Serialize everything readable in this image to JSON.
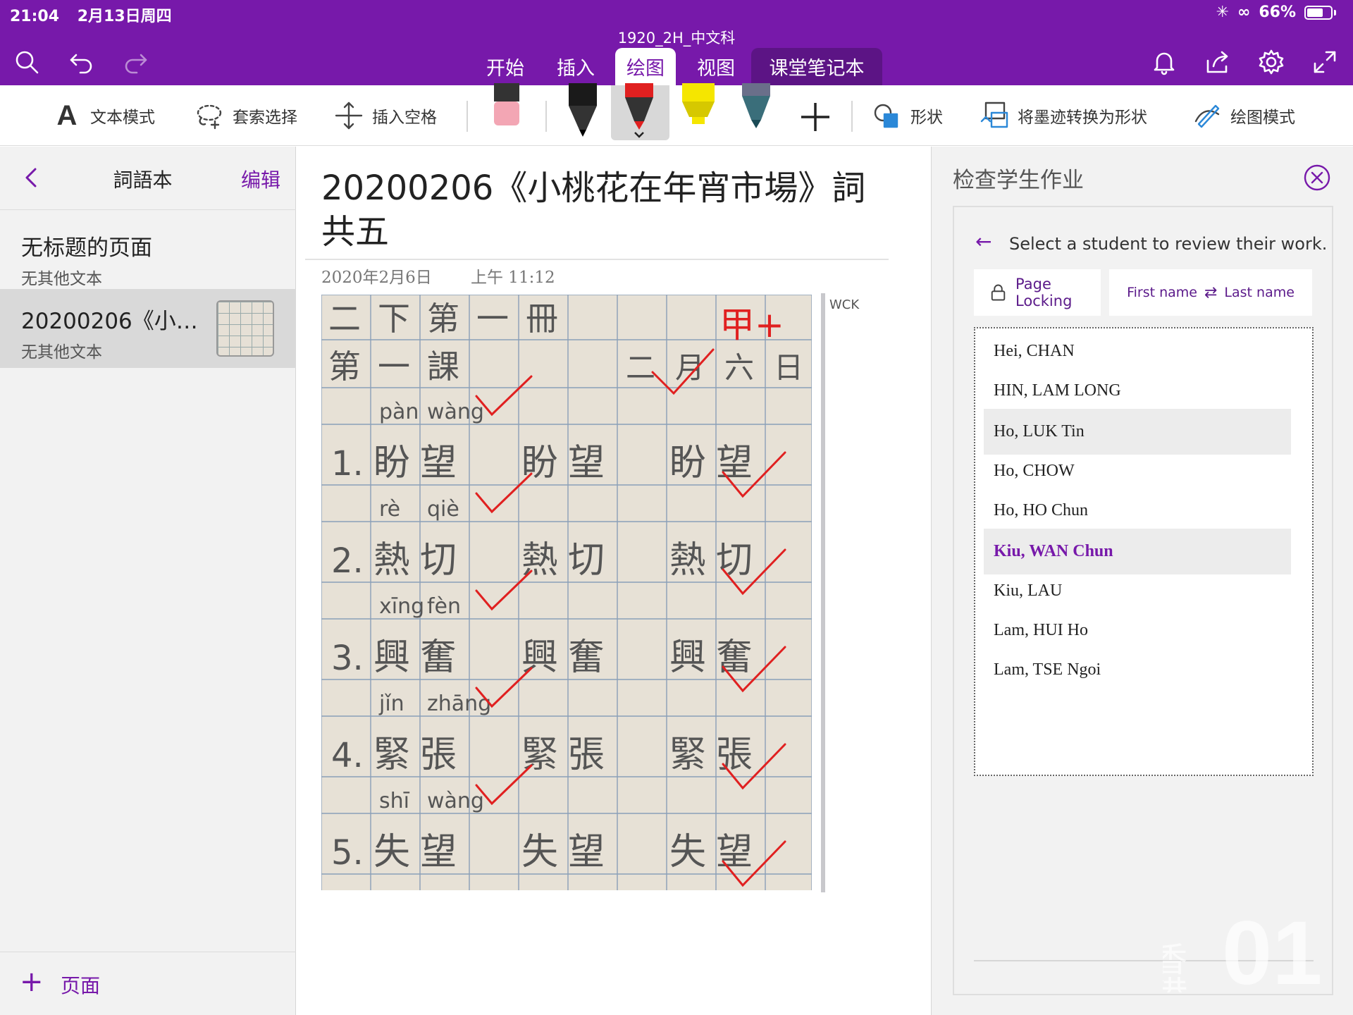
{
  "status_bar": {
    "time": "21:04",
    "date": "2月13日周四",
    "battery": "66%"
  },
  "app": {
    "doc_title": "1920_2H_中文科"
  },
  "tabs": [
    {
      "label": "开始"
    },
    {
      "label": "插入"
    },
    {
      "label": "绘图"
    },
    {
      "label": "视图"
    },
    {
      "label": "课堂笔记本"
    }
  ],
  "active_tab": "绘图",
  "ribbon": {
    "text_mode": "文本模式",
    "lasso_select": "套索选择",
    "insert_space": "插入空格",
    "shapes": "形状",
    "ink_to_shape": "将墨迹转换为形状",
    "drawing_mode": "绘图模式"
  },
  "pen_colors": {
    "black": "#1a1a1a",
    "red": "#e02020",
    "yellow": "#f5e600",
    "teal": "#3a6e7a",
    "eraser": "#f3a6b4"
  },
  "left_panel": {
    "title": "詞語本",
    "edit": "编辑",
    "pages": [
      {
        "title": "无标题的页面",
        "subtitle": "无其他文本"
      },
      {
        "title": "20200206《小…",
        "subtitle": "无其他文本"
      }
    ],
    "add_page": "页面"
  },
  "page": {
    "title": "20200206《小桃花在年宵市場》詞共五",
    "date": "2020年2月6日",
    "time": "上午  11:12",
    "author": "WCK"
  },
  "worksheet": {
    "header_row": [
      "二",
      "下",
      "第",
      "一",
      "冊"
    ],
    "lesson": [
      "第",
      "一",
      "課"
    ],
    "date_text": [
      "二",
      "月",
      "六",
      "日"
    ],
    "grade": "甲+",
    "rows": [
      {
        "num": "1.",
        "pinyin": [
          "pàn",
          "wàng"
        ],
        "chars": [
          "盼",
          "望"
        ]
      },
      {
        "num": "2.",
        "pinyin": [
          "rè",
          "qiè"
        ],
        "chars": [
          "熱",
          "切"
        ]
      },
      {
        "num": "3.",
        "pinyin": [
          "xīng",
          "fèn"
        ],
        "chars": [
          "興",
          "奮"
        ]
      },
      {
        "num": "4.",
        "pinyin": [
          "jǐn",
          "zhāng"
        ],
        "chars": [
          "緊",
          "張"
        ]
      },
      {
        "num": "5.",
        "pinyin": [
          "shī",
          "wàng"
        ],
        "chars": [
          "失",
          "望"
        ]
      }
    ]
  },
  "review_panel": {
    "title": "检查学生作业",
    "prompt": "Select a student to review their work.",
    "page_locking": "Page Locking",
    "sort_first": "First name",
    "sort_last": "Last name",
    "students": [
      {
        "name": "Hei, CHAN"
      },
      {
        "name": "HIN, LAM LONG"
      },
      {
        "name": "Ho, LUK Tin"
      },
      {
        "name": "Ho, CHOW"
      },
      {
        "name": "Ho, HO Chun"
      },
      {
        "name": "Kiu, WAN Chun"
      },
      {
        "name": "Kiu, LAU"
      },
      {
        "name": "Lam, HUI Ho"
      },
      {
        "name": "Lam, TSE Ngoi"
      }
    ],
    "selected_student": "Kiu, WAN Chun",
    "hovered_student": "Ho, LUK Tin"
  },
  "watermark": {
    "text": "香港",
    "logo": "01"
  },
  "colors": {
    "brand_purple": "#7719aa",
    "panel_gray": "#f2f2f2",
    "check_red": "#e02020"
  }
}
